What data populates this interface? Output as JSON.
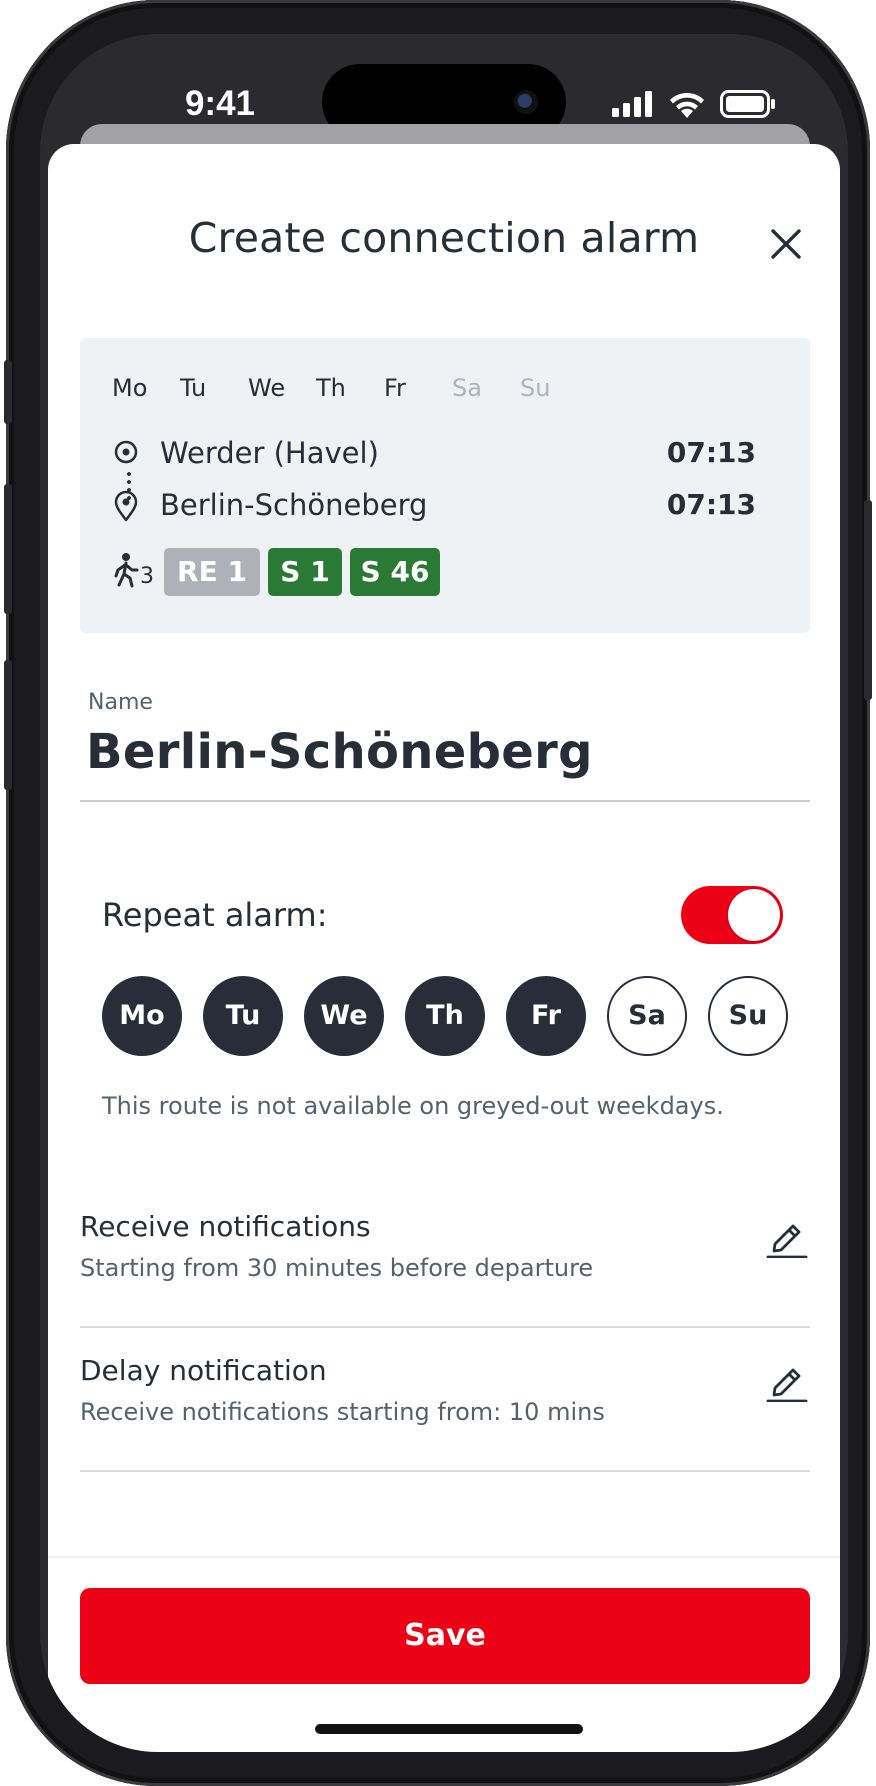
{
  "status_bar": {
    "time": "9:41"
  },
  "sheet": {
    "title": "Create connection alarm"
  },
  "route_card": {
    "days": [
      {
        "label": "Mo",
        "available": true
      },
      {
        "label": "Tu",
        "available": true
      },
      {
        "label": "We",
        "available": true
      },
      {
        "label": "Th",
        "available": true
      },
      {
        "label": "Fr",
        "available": true
      },
      {
        "label": "Sa",
        "available": false
      },
      {
        "label": "Su",
        "available": false
      }
    ],
    "origin": {
      "name": "Werder (Havel)",
      "time": "07:13"
    },
    "destination": {
      "name": "Berlin-Schöneberg",
      "time": "07:13"
    },
    "transfers": "3",
    "lines": [
      {
        "label": "RE 1",
        "color": "#aeb2b8"
      },
      {
        "label": "S 1",
        "color": "#2a7a35"
      },
      {
        "label": "S 46",
        "color": "#2a7a35"
      }
    ]
  },
  "name_field": {
    "label": "Name",
    "value": "Berlin-Schöneberg"
  },
  "repeat": {
    "label": "Repeat alarm:",
    "enabled": true,
    "days": [
      {
        "label": "Mo",
        "selected": true
      },
      {
        "label": "Tu",
        "selected": true
      },
      {
        "label": "We",
        "selected": true
      },
      {
        "label": "Th",
        "selected": true
      },
      {
        "label": "Fr",
        "selected": true
      },
      {
        "label": "Sa",
        "selected": false
      },
      {
        "label": "Su",
        "selected": false
      }
    ],
    "hint": "This route is not available on greyed-out weekdays."
  },
  "settings": [
    {
      "title": "Receive notifications",
      "subtitle": "Starting from 30 minutes before departure",
      "icon": "pencil-icon"
    },
    {
      "title": "Delay notification",
      "subtitle": "Receive notifications starting from: 10 mins",
      "icon": "pencil-icon"
    }
  ],
  "footer": {
    "save_label": "Save"
  },
  "colors": {
    "accent": "#ec0016",
    "text": "#282d37",
    "card_bg": "#eff2f4",
    "line_green": "#2a7a35"
  }
}
